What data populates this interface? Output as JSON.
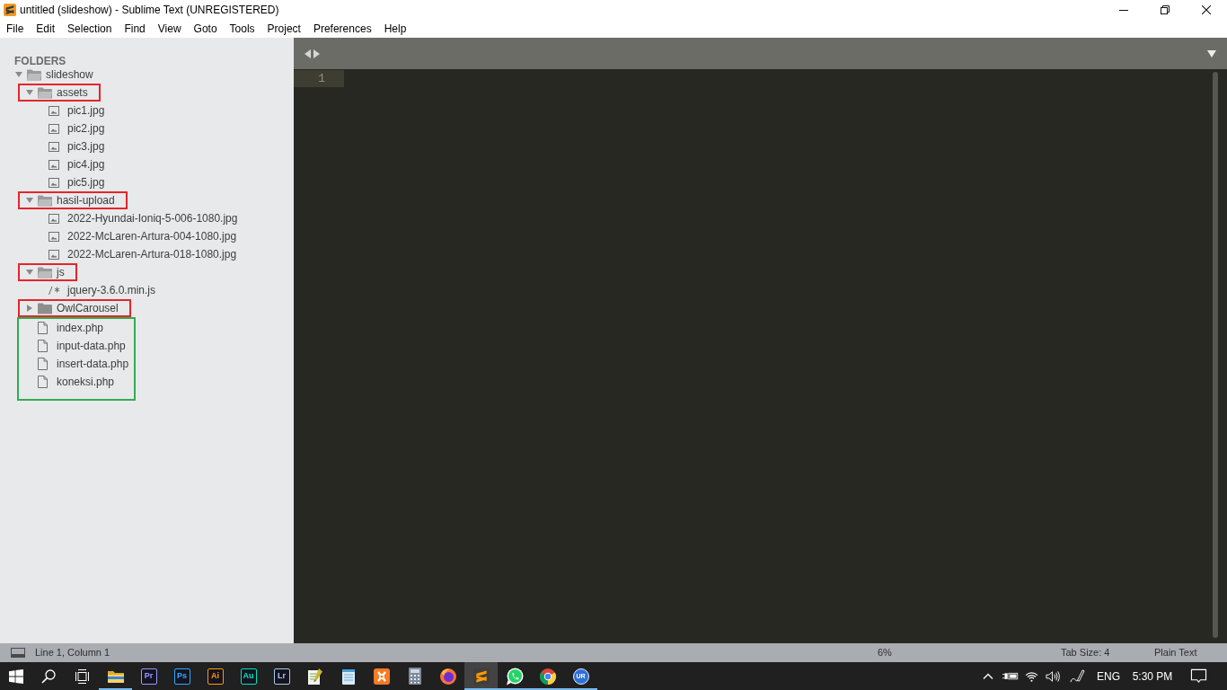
{
  "window": {
    "title": "untitled (slideshow) - Sublime Text (UNREGISTERED)"
  },
  "menu": [
    "File",
    "Edit",
    "Selection",
    "Find",
    "View",
    "Goto",
    "Tools",
    "Project",
    "Preferences",
    "Help"
  ],
  "sidebar": {
    "title": "FOLDERS",
    "tree": [
      {
        "kind": "folder",
        "name": "slideshow",
        "expanded": true,
        "children": [
          {
            "kind": "folder",
            "name": "assets",
            "expanded": true,
            "annotation": {
              "color": "#e3262b"
            },
            "children": [
              {
                "kind": "image",
                "name": "pic1.jpg"
              },
              {
                "kind": "image",
                "name": "pic2.jpg"
              },
              {
                "kind": "image",
                "name": "pic3.jpg"
              },
              {
                "kind": "image",
                "name": "pic4.jpg"
              },
              {
                "kind": "image",
                "name": "pic5.jpg"
              }
            ]
          },
          {
            "kind": "folder",
            "name": "hasil-upload",
            "expanded": true,
            "annotation": {
              "color": "#e3262b"
            },
            "children": [
              {
                "kind": "image",
                "name": "2022-Hyundai-Ioniq-5-006-1080.jpg"
              },
              {
                "kind": "image",
                "name": "2022-McLaren-Artura-004-1080.jpg"
              },
              {
                "kind": "image",
                "name": "2022-McLaren-Artura-018-1080.jpg"
              }
            ]
          },
          {
            "kind": "folder",
            "name": "js",
            "expanded": true,
            "annotation": {
              "color": "#e3262b"
            },
            "children": [
              {
                "kind": "script",
                "name": "jquery-3.6.0.min.js"
              }
            ]
          },
          {
            "kind": "folder",
            "name": "OwlCarousel",
            "expanded": false,
            "annotation": {
              "color": "#e3262b"
            }
          },
          {
            "kind": "file",
            "name": "index.php",
            "annotation": {
              "color": "#31ac52"
            }
          },
          {
            "kind": "file",
            "name": "input-data.php",
            "annotation": {
              "color": "#31ac52"
            }
          },
          {
            "kind": "file",
            "name": "insert-data.php",
            "annotation": {
              "color": "#31ac52"
            }
          },
          {
            "kind": "file",
            "name": "koneksi.php",
            "annotation": {
              "color": "#31ac52"
            }
          }
        ]
      }
    ]
  },
  "editor": {
    "lines": [
      {
        "number": "1",
        "current": true
      }
    ]
  },
  "status_bar": {
    "position": "Line 1, Column 1",
    "percentage": "6%",
    "tab_size": "Tab Size: 4",
    "syntax": "Plain Text"
  },
  "taskbar": {
    "apps": [
      {
        "kind": "explorer",
        "running": true,
        "active": false
      },
      {
        "kind": "tile",
        "label": "Pr",
        "color": "#9999ff",
        "running": false,
        "active": false
      },
      {
        "kind": "tile",
        "label": "Ps",
        "color": "#31a8ff",
        "running": false,
        "active": false
      },
      {
        "kind": "tile",
        "label": "Ai",
        "color": "#ff9a00",
        "running": false,
        "active": false
      },
      {
        "kind": "tile",
        "label": "Au",
        "color": "#00e4bb",
        "running": false,
        "active": false
      },
      {
        "kind": "tile",
        "label": "Lr",
        "color": "#a8c8e8",
        "running": false,
        "active": false
      },
      {
        "kind": "notepad-plus",
        "running": false,
        "active": false
      },
      {
        "kind": "notepad",
        "running": false,
        "active": false
      },
      {
        "kind": "xampp",
        "running": false,
        "active": false
      },
      {
        "kind": "calculator",
        "running": false,
        "active": false
      },
      {
        "kind": "firefox",
        "running": false,
        "active": false
      },
      {
        "kind": "sublime",
        "running": true,
        "active": true
      },
      {
        "kind": "whatsapp",
        "running": true,
        "active": false
      },
      {
        "kind": "chrome",
        "running": true,
        "active": false
      },
      {
        "kind": "badge",
        "label": "UR",
        "running": true,
        "active": false
      }
    ]
  },
  "tray": {
    "language": "ENG",
    "time": "5:30 PM"
  }
}
